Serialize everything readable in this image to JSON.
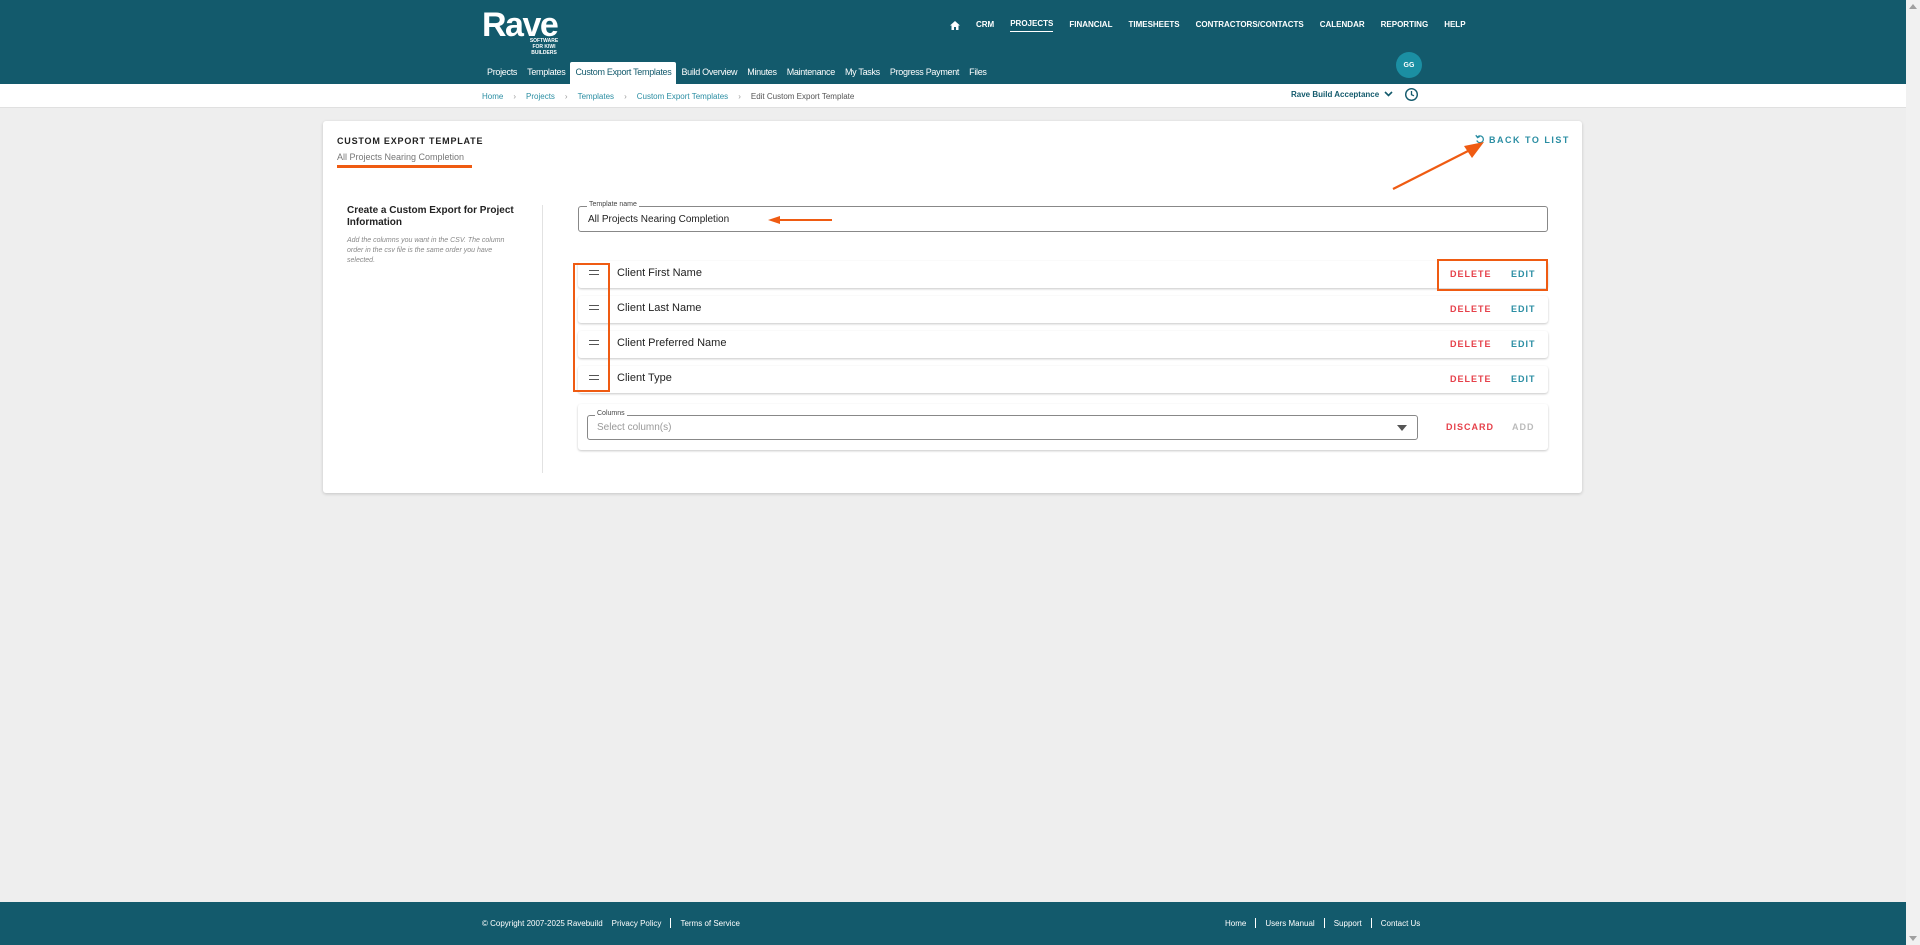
{
  "brand": {
    "name": "Rave",
    "tagline": "SOFTWARE FOR KIWI BUILDERS"
  },
  "mainnav": [
    {
      "label": "CRM"
    },
    {
      "label": "PROJECTS",
      "active": true
    },
    {
      "label": "FINANCIAL"
    },
    {
      "label": "TIMESHEETS"
    },
    {
      "label": "CONTRACTORS/CONTACTS"
    },
    {
      "label": "CALENDAR"
    },
    {
      "label": "REPORTING"
    },
    {
      "label": "HELP"
    }
  ],
  "subnav": [
    {
      "label": "Projects"
    },
    {
      "label": "Templates"
    },
    {
      "label": "Custom Export Templates",
      "active": true
    },
    {
      "label": "Build Overview"
    },
    {
      "label": "Minutes"
    },
    {
      "label": "Maintenance"
    },
    {
      "label": "My Tasks"
    },
    {
      "label": "Progress Payment"
    },
    {
      "label": "Files"
    }
  ],
  "user": {
    "initials": "GG"
  },
  "breadcrumb": [
    "Home",
    "Projects",
    "Templates",
    "Custom Export Templates",
    "Edit Custom Export Template"
  ],
  "org": {
    "name": "Rave Build Acceptance"
  },
  "card": {
    "title": "CUSTOM EXPORT TEMPLATE",
    "subtitle": "All Projects Nearing Completion",
    "back_label": "BACK TO LIST"
  },
  "side": {
    "title": "Create a Custom Export for Project Information",
    "description": "Add the columns you want in the CSV. The column order in the csv file is the same order you have selected."
  },
  "template_name": {
    "label": "Template name",
    "value": "All Projects Nearing Completion"
  },
  "columns": [
    {
      "name": "Client First Name",
      "delete_label": "DELETE",
      "edit_label": "EDIT"
    },
    {
      "name": "Client Last Name",
      "delete_label": "DELETE",
      "edit_label": "EDIT"
    },
    {
      "name": "Client Preferred Name",
      "delete_label": "DELETE",
      "edit_label": "EDIT"
    },
    {
      "name": "Client Type",
      "delete_label": "DELETE",
      "edit_label": "EDIT"
    }
  ],
  "add_column": {
    "label": "Columns",
    "placeholder": "Select column(s)",
    "discard_label": "DISCARD",
    "add_label": "ADD"
  },
  "footer": {
    "copyright": "© Copyright 2007-2025 Ravebuild",
    "left_links": [
      "Privacy Policy",
      "Terms of Service"
    ],
    "right_links": [
      "Home",
      "Users Manual",
      "Support",
      "Contact Us"
    ]
  },
  "colors": {
    "header": "#135a6c",
    "accent": "#2b8ea3",
    "danger": "#e6404a",
    "annotation": "#ef5b12"
  }
}
